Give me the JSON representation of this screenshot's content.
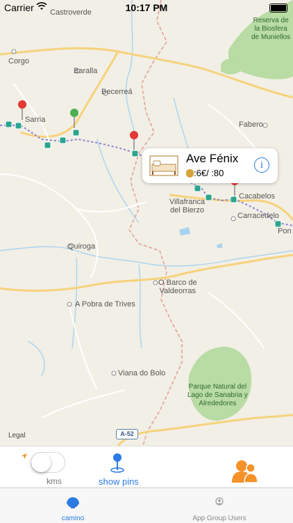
{
  "status_bar": {
    "carrier": "Carrier",
    "time": "10:17 PM"
  },
  "map": {
    "labels": {
      "castroverde": "Castroverde",
      "reserva": "Reserva de\nla Biosfera\nde Muniellos",
      "corgo": "Corgo",
      "baralla": "Baralla",
      "becerrea": "Becerreá",
      "sarria": "Sarria",
      "fabero": "Fabero",
      "cacabelos": "Cacabelos",
      "villafranca": "Villafranca\ndel Bierzo",
      "carracedelo": "Carracedelo",
      "ponf": "Pon",
      "quiroga": "Quiroga",
      "barco": "O Barco de\nValdeorras",
      "pobra": "A Pobra de Trives",
      "viana": "Viana do Bolo",
      "parque": "Parque Natural del\nLago de Sanabria y\nAlrededores"
    },
    "legal": "Legal",
    "road_shield": "A-52",
    "callout": {
      "title": "Ave Fénix",
      "details": ":6€/  :80"
    }
  },
  "controls": {
    "kms_label": "kms",
    "show_pins_label": "show pins"
  },
  "tabs": [
    {
      "label": "camino"
    },
    {
      "label": "App Group Users"
    }
  ],
  "colors": {
    "accent": "#2b7be3",
    "route": "#8a7fd6",
    "orange": "#f5922a",
    "pin_red": "#e53935",
    "pin_green": "#4caf50",
    "marker_teal": "#2aa58e",
    "park": "#b9dba4",
    "water": "#a8d3f0"
  }
}
